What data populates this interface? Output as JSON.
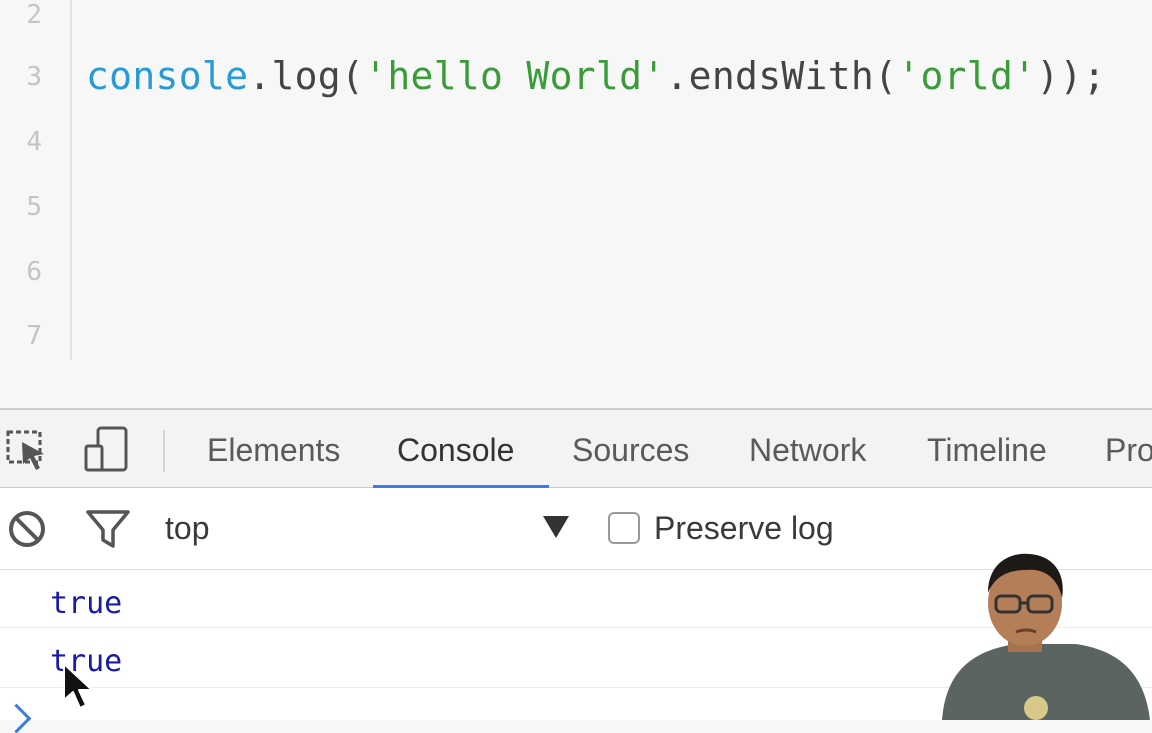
{
  "editor": {
    "line_numbers": [
      "2",
      "3",
      "4",
      "5",
      "6",
      "7"
    ],
    "code": {
      "object": "console",
      "dot1": ".",
      "method": "log(",
      "string1": "'hello World'",
      "dot2": ".endsWith(",
      "string2": "'orld'",
      "close": "));"
    }
  },
  "devtools": {
    "tabs": [
      "Elements",
      "Console",
      "Sources",
      "Network",
      "Timeline",
      "Pro"
    ],
    "active_tab": "Console",
    "toolbar": {
      "context": "top",
      "preserve_log_label": "Preserve log",
      "preserve_log_checked": false
    },
    "console_output": [
      "true",
      "true"
    ]
  },
  "colors": {
    "accent": "#3b7ae8",
    "console_value": "#1a1aa6",
    "code_object": "#2a9ad6",
    "code_string": "#3a9b3a"
  },
  "icons": {
    "inspect": "inspect-element-icon",
    "device": "device-mode-icon",
    "clear": "clear-console-icon",
    "filter": "filter-icon",
    "dropdown": "dropdown-arrow-icon",
    "prompt": "console-prompt-icon",
    "cursor": "mouse-cursor-icon"
  }
}
